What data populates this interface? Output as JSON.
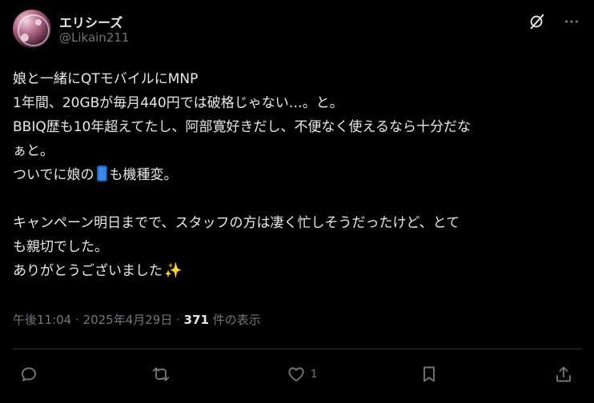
{
  "author": {
    "display_name": "エリシーズ",
    "handle": "@Likain211",
    "avatar_icon": "avatar-icon"
  },
  "header_icons": {
    "grok": "grok-icon",
    "more": "more-icon"
  },
  "post": {
    "lines": [
      "娘と一緒にQTモバイルにMNP",
      "1年間、20GBが毎月440円では破格じゃない…。と。",
      "BBIQ歴も10年超えてたし、阿部寛好きだし、不便なく使えるなら十分だな",
      "ぁと。",
      "ついでに娘の",
      "も機種変。",
      "キャンペーン明日までで、スタッフの方は凄く忙しそうだったけど、とて",
      "も親切でした。",
      "ありがとうございました"
    ],
    "emoji_phone": "mobile-phone-emoji",
    "emoji_sparkle": "✨"
  },
  "meta": {
    "time": "午後11:04",
    "separator": " · ",
    "date": "2025年4月29日",
    "views_count": "371",
    "views_label": " 件の表示"
  },
  "actions": {
    "reply": {
      "icon": "reply-icon",
      "count": ""
    },
    "repost": {
      "icon": "repost-icon",
      "count": ""
    },
    "like": {
      "icon": "like-icon",
      "count": "1"
    },
    "bookmark": {
      "icon": "bookmark-icon",
      "count": ""
    },
    "share": {
      "icon": "share-icon",
      "count": ""
    }
  },
  "colors": {
    "background": "#000000",
    "text": "#e7e9ea",
    "secondary": "#71767b",
    "divider": "#2f3336"
  }
}
